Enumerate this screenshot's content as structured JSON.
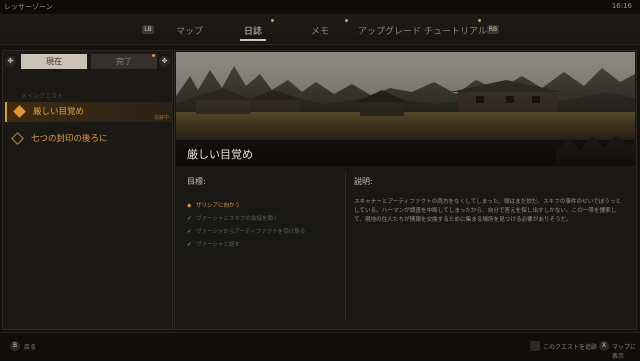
{
  "status_bar": {
    "zone": "レッサーゾーン",
    "clock": "16:16"
  },
  "tabs": [
    {
      "label": "マップ",
      "active": false
    },
    {
      "label": "日誌",
      "active": true
    },
    {
      "label": "メモ",
      "active": false
    },
    {
      "label": "アップグレード",
      "active": false
    },
    {
      "label": "チュートリアル",
      "active": false
    }
  ],
  "tab_hints": {
    "prev": "LB",
    "next": "RB"
  },
  "filter": {
    "current_label": "現在",
    "done_label": "完了"
  },
  "quest_list": {
    "category": "メインクエスト",
    "items": [
      {
        "title": "厳しい目覚め",
        "subtitle": "",
        "tag": "追跡中",
        "selected": true
      },
      {
        "title": "七つの封印の後ろに",
        "subtitle": "",
        "tag": "",
        "selected": false
      }
    ]
  },
  "detail": {
    "title": "厳しい目覚め",
    "objectives_heading": "目標:",
    "description_heading": "説明:",
    "objectives": [
      {
        "text": "ザリシアに向かう",
        "state": "current"
      },
      {
        "text": "ヴァーシャとスキフの会話を聞く",
        "state": "done"
      },
      {
        "text": "ヴァーシャからアーティファクトを受け取る",
        "state": "done"
      },
      {
        "text": "ヴァーシャと話す",
        "state": "done"
      }
    ],
    "description": "スキャナーとアーティファクトの両方をなくしてしまった。頭はまだ妙だ。スキフの事件のせいでぼうっとしている。ハーマンが調査を中断してしまったから、自分で答えを探し出すしかない。この一帯を捜索して、現地の住人たちが情報を交換するために集まる場所を見つける必要がありそうだ。"
  },
  "footer": {
    "back_button": "B",
    "back_label": "戻る",
    "track_button": "",
    "track_label": "このクエストを追跡",
    "map_button": "X",
    "map_label": "マップに表示"
  },
  "colors": {
    "accent": "#e0982a",
    "completed": "#5c9a3a",
    "background": "#141210"
  }
}
